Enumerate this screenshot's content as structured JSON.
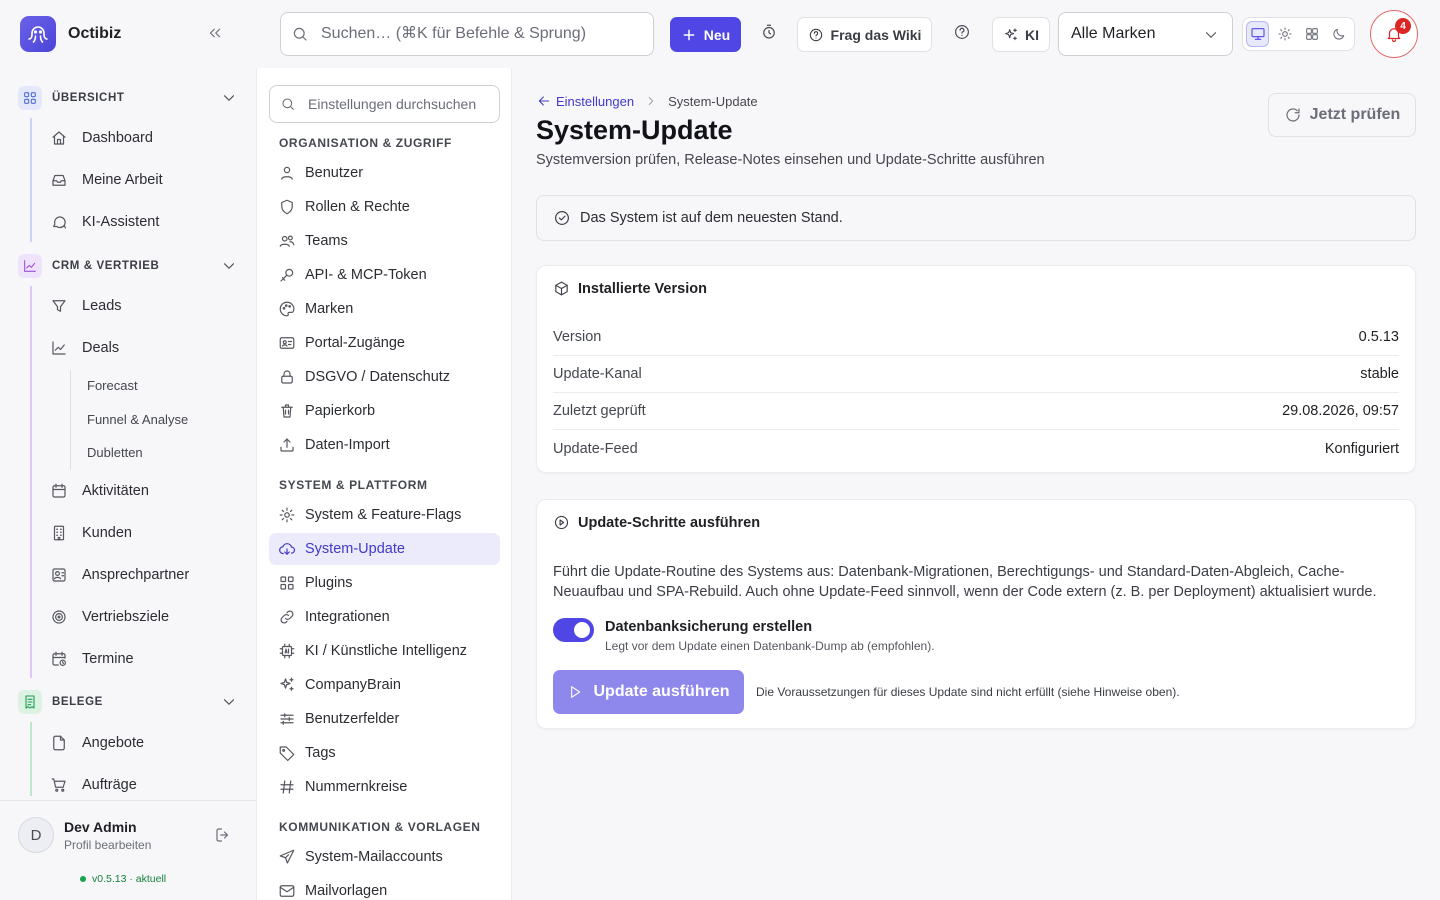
{
  "app": {
    "name": "Octibiz"
  },
  "topbar": {
    "search_placeholder": "Suchen… (⌘K für Befehle & Sprung)",
    "new_label": "Neu",
    "wiki_label": "Frag das Wiki",
    "ki_label": "KI",
    "brand_select": "Alle Marken",
    "notification_count": "4"
  },
  "sidebar": {
    "groups": [
      {
        "label": "ÜBERSICHT",
        "items": [
          "Dashboard",
          "Meine Arbeit",
          "KI-Assistent"
        ]
      },
      {
        "label": "CRM & VERTRIEB",
        "items": [
          "Leads",
          "Deals",
          "Aktivitäten",
          "Kunden",
          "Ansprechpartner",
          "Vertriebsziele",
          "Termine"
        ]
      },
      {
        "label": "BELEGE",
        "items": [
          "Angebote",
          "Aufträge"
        ]
      }
    ],
    "deal_subitems": [
      "Forecast",
      "Funnel & Analyse",
      "Dubletten"
    ],
    "user": {
      "initial": "D",
      "name": "Dev Admin",
      "sub": "Profil bearbeiten"
    },
    "version": "v0.5.13 · aktuell"
  },
  "settings": {
    "search_placeholder": "Einstellungen durchsuchen",
    "sections": [
      {
        "label": "ORGANISATION & ZUGRIFF",
        "items": [
          "Benutzer",
          "Rollen & Rechte",
          "Teams",
          "API- & MCP-Token",
          "Marken",
          "Portal-Zugänge",
          "DSGVO / Datenschutz",
          "Papierkorb",
          "Daten-Import"
        ]
      },
      {
        "label": "SYSTEM & PLATTFORM",
        "items": [
          "System & Feature-Flags",
          "System-Update",
          "Plugins",
          "Integrationen",
          "KI / Künstliche Intelligenz",
          "CompanyBrain",
          "Benutzerfelder",
          "Tags",
          "Nummernkreise"
        ]
      },
      {
        "label": "KOMMUNIKATION & VORLAGEN",
        "items": [
          "System-Mailaccounts",
          "Mailvorlagen"
        ]
      }
    ]
  },
  "main": {
    "breadcrumb_parent": "Einstellungen",
    "breadcrumb_current": "System-Update",
    "title": "System-Update",
    "subtitle": "Systemversion prüfen, Release-Notes einsehen und Update-Schritte ausführen",
    "check_button": "Jetzt prüfen",
    "status_message": "Das System ist auf dem neuesten Stand.",
    "installed": {
      "title": "Installierte Version",
      "rows": [
        {
          "key": "Version",
          "value": "0.5.13"
        },
        {
          "key": "Update-Kanal",
          "value": "stable"
        },
        {
          "key": "Zuletzt geprüft",
          "value": "29.08.2026, 09:57"
        },
        {
          "key": "Update-Feed",
          "value": "Konfiguriert"
        }
      ]
    },
    "steps": {
      "title": "Update-Schritte ausführen",
      "description": "Führt die Update-Routine des Systems aus: Datenbank-Migrationen, Berechtigungs- und Standard-Daten-Abgleich, Cache-Neuaufbau und SPA-Rebuild. Auch ohne Update-Feed sinnvoll, wenn der Code extern (z. B. per Deployment) aktualisiert wurde.",
      "backup_label": "Datenbanksicherung erstellen",
      "backup_help": "Legt vor dem Update einen Datenbank-Dump ab (empfohlen).",
      "backup_enabled": true,
      "run_button": "Update ausführen",
      "run_hint": "Die Voraussetzungen für dieses Update sind nicht erfüllt (siehe Hinweise oben)."
    }
  },
  "colors": {
    "accent": "#4f46e5",
    "accent_disabled": "#8f88ec",
    "danger": "#dc2626",
    "success": "#16a34a"
  }
}
